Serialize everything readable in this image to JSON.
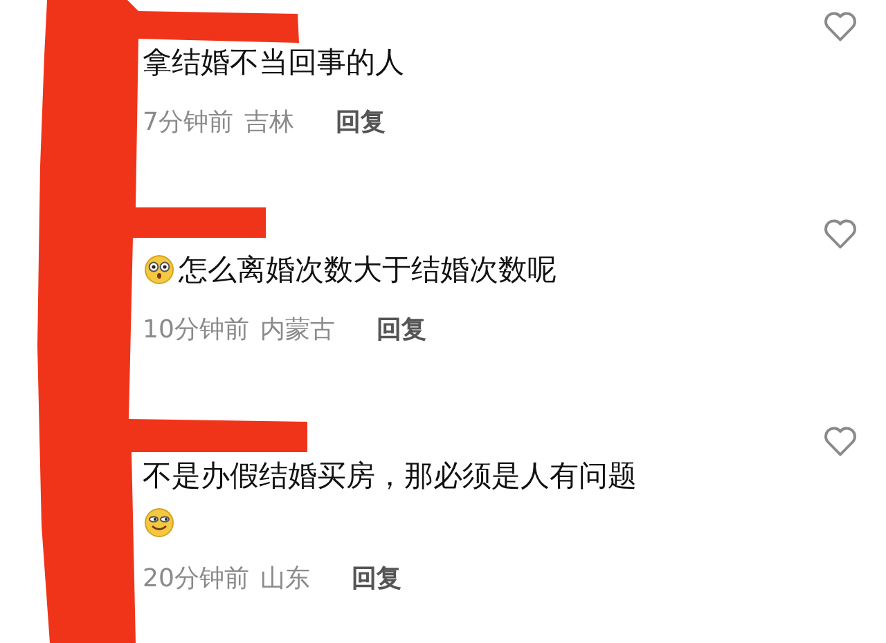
{
  "comments": [
    {
      "content": [
        {
          "kind": "text",
          "text": "拿结婚不当回事的人"
        }
      ],
      "time": "7分钟前",
      "location": "吉林",
      "reply": "回复",
      "liked": false
    },
    {
      "content": [
        {
          "kind": "shocked"
        },
        {
          "kind": "text",
          "text": "怎么离婚次数大于结婚次数呢"
        }
      ],
      "time": "10分钟前",
      "location": "内蒙古",
      "reply": "回复",
      "liked": false
    },
    {
      "content": [
        {
          "kind": "text",
          "text": "不是办假结婚买房，那必须是人有问题"
        },
        {
          "kind": "break"
        },
        {
          "kind": "smirk"
        }
      ],
      "time": "20分钟前",
      "location": "山东",
      "reply": "回复",
      "liked": false
    }
  ]
}
